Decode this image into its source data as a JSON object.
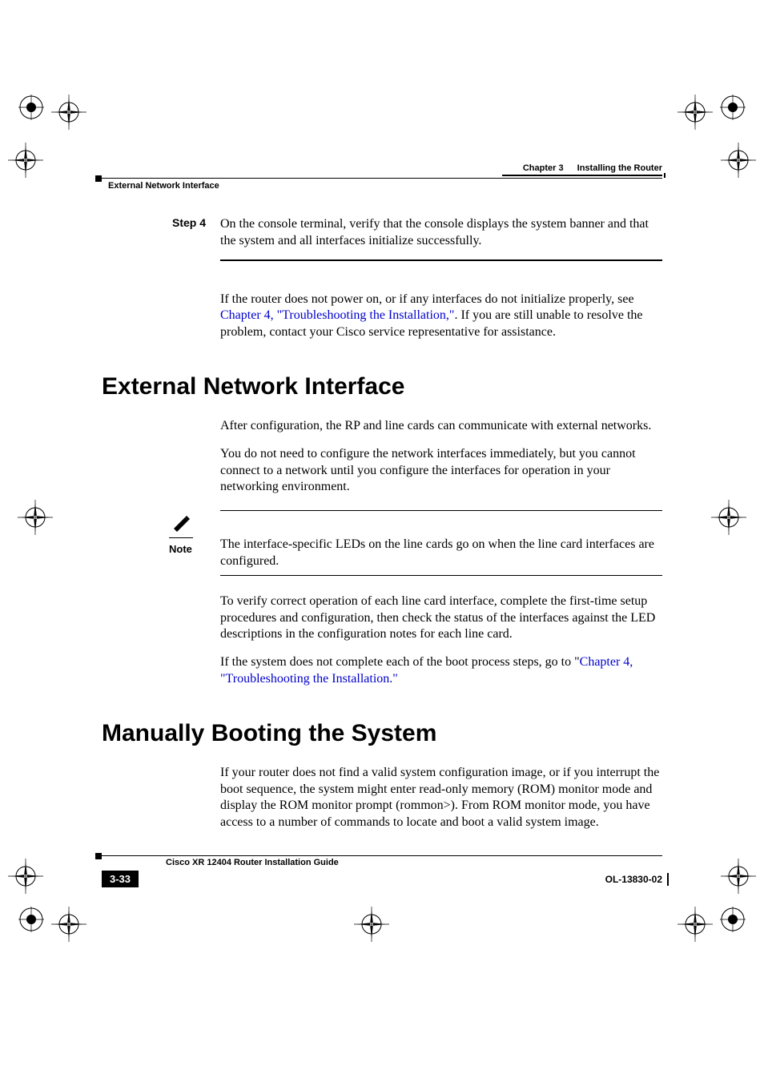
{
  "header": {
    "chapter_num": "Chapter 3",
    "chapter_title": "Installing the Router",
    "section_title": "External Network Interface"
  },
  "step4": {
    "label": "Step 4",
    "text": "On the console terminal, verify that the console displays the system banner and that the system and all interfaces initialize successfully."
  },
  "para_poweron": {
    "before_link": "If the router does not power on, or if any interfaces do not initialize properly, see ",
    "link": "Chapter 4, \"Troubleshooting the Installation,\"",
    "after_link": ". If you are still unable to resolve the problem, contact your Cisco service representative for assistance."
  },
  "h1_external": "External Network Interface",
  "para_after_config": "After configuration, the RP and line cards can communicate with external networks.",
  "para_no_need": "You do not need to configure the network interfaces immediately, but you cannot connect to a network until you configure the interfaces for operation in your networking environment.",
  "note": {
    "label": "Note",
    "text": "The interface-specific LEDs on the line cards go on when the line card interfaces are configured."
  },
  "para_verify": "To verify correct operation of each line card interface, complete the first-time setup procedures and configuration, then check the status of the interfaces against the LED descriptions in the configuration notes for each line card.",
  "para_boot": {
    "before_link": "If the system does not complete each of the boot process steps, go to \"",
    "link": "Chapter 4, \"Troubleshooting the Installation.\"",
    "after_link": ""
  },
  "h1_manual": "Manually Booting the System",
  "para_manual": "If your router does not find a valid system configuration image, or if you interrupt the boot sequence, the system might enter read-only memory (ROM) monitor mode and display the ROM monitor prompt (rommon>). From ROM monitor mode, you have access to a number of commands to locate and boot a valid system image.",
  "footer": {
    "guide_title": "Cisco XR 12404 Router Installation Guide",
    "page_num": "3-33",
    "doc_id": "OL-13830-02"
  }
}
